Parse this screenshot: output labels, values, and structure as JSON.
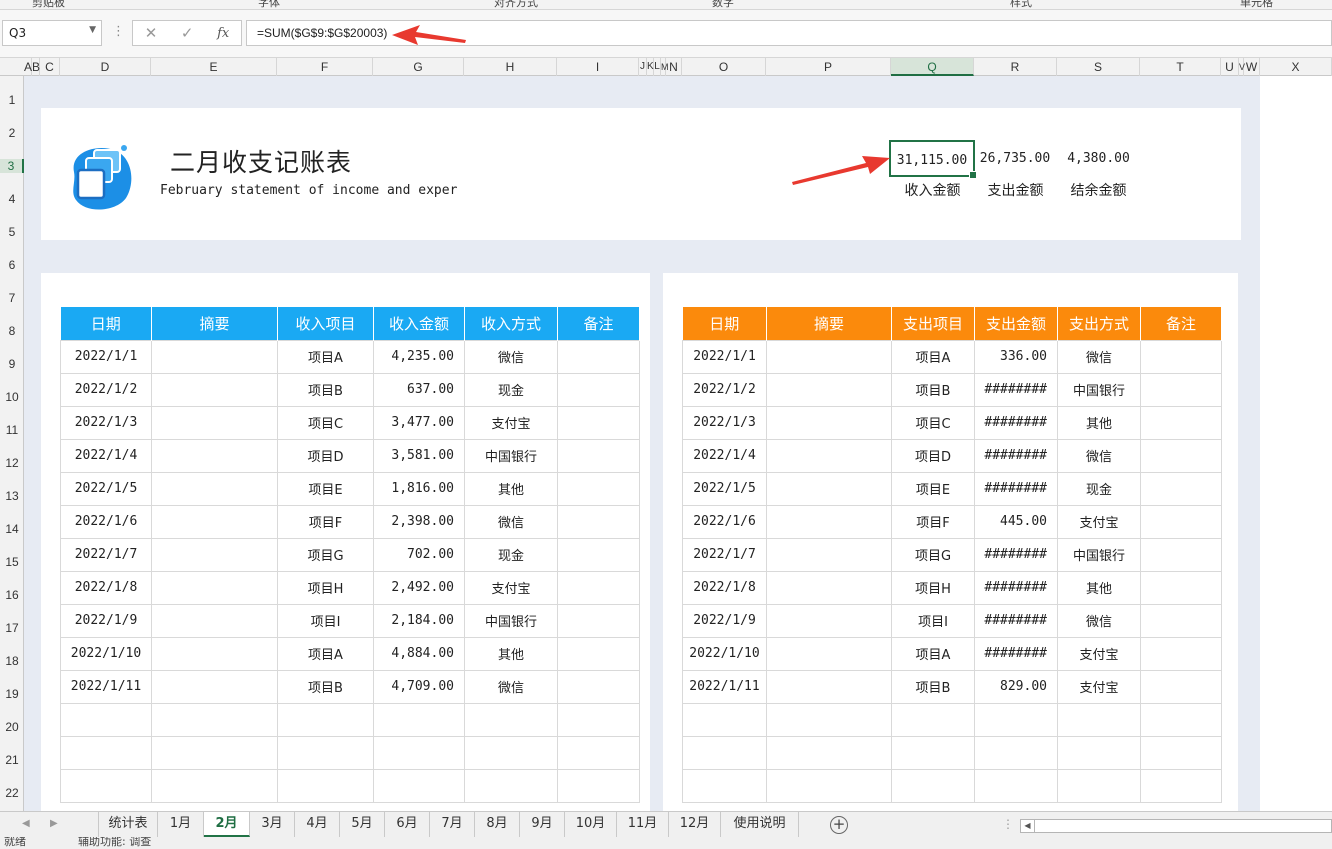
{
  "ribbon": {
    "groups": [
      "剪贴板",
      "字体",
      "对齐方式",
      "数字",
      "样式",
      "单元格"
    ]
  },
  "formula_bar": {
    "name_box": "Q3",
    "formula": "=SUM($G$9:$G$20003)",
    "fx_label": "fx",
    "cancel_glyph": "✕",
    "enter_glyph": "✓"
  },
  "columns": [
    "A",
    "B",
    "C",
    "D",
    "E",
    "F",
    "G",
    "H",
    "I",
    "J",
    "K",
    "L",
    "M",
    "N",
    "O",
    "P",
    "Q",
    "R",
    "S",
    "T",
    "U",
    "V",
    "W",
    "X"
  ],
  "rows": [
    "1",
    "2",
    "3",
    "4",
    "5",
    "6",
    "7",
    "8",
    "9",
    "10",
    "11",
    "12",
    "13",
    "14",
    "15",
    "16",
    "17",
    "18",
    "19",
    "20",
    "21",
    "22"
  ],
  "header": {
    "title": "二月收支记账表",
    "subtitle": "February statement of income and exper"
  },
  "summary": {
    "income_value": "31,115.00",
    "expense_value": "26,735.00",
    "balance_value": "4,380.00",
    "income_label": "收入金额",
    "expense_label": "支出金额",
    "balance_label": "结余金额"
  },
  "income_table": {
    "headers": [
      "日期",
      "摘要",
      "收入项目",
      "收入金额",
      "收入方式",
      "备注"
    ],
    "rows": [
      [
        "2022/1/1",
        "",
        "项目A",
        "4,235.00",
        "微信",
        ""
      ],
      [
        "2022/1/2",
        "",
        "项目B",
        "637.00",
        "现金",
        ""
      ],
      [
        "2022/1/3",
        "",
        "项目C",
        "3,477.00",
        "支付宝",
        ""
      ],
      [
        "2022/1/4",
        "",
        "项目D",
        "3,581.00",
        "中国银行",
        ""
      ],
      [
        "2022/1/5",
        "",
        "项目E",
        "1,816.00",
        "其他",
        ""
      ],
      [
        "2022/1/6",
        "",
        "项目F",
        "2,398.00",
        "微信",
        ""
      ],
      [
        "2022/1/7",
        "",
        "项目G",
        "702.00",
        "现金",
        ""
      ],
      [
        "2022/1/8",
        "",
        "项目H",
        "2,492.00",
        "支付宝",
        ""
      ],
      [
        "2022/1/9",
        "",
        "项目I",
        "2,184.00",
        "中国银行",
        ""
      ],
      [
        "2022/1/10",
        "",
        "项目A",
        "4,884.00",
        "其他",
        ""
      ],
      [
        "2022/1/11",
        "",
        "项目B",
        "4,709.00",
        "微信",
        ""
      ],
      [
        "",
        "",
        "",
        "",
        "",
        ""
      ],
      [
        "",
        "",
        "",
        "",
        "",
        ""
      ],
      [
        "",
        "",
        "",
        "",
        "",
        ""
      ]
    ]
  },
  "expense_table": {
    "headers": [
      "日期",
      "摘要",
      "支出项目",
      "支出金额",
      "支出方式",
      "备注"
    ],
    "rows": [
      [
        "2022/1/1",
        "",
        "项目A",
        "336.00",
        "微信",
        ""
      ],
      [
        "2022/1/2",
        "",
        "项目B",
        "########",
        "中国银行",
        ""
      ],
      [
        "2022/1/3",
        "",
        "项目C",
        "########",
        "其他",
        ""
      ],
      [
        "2022/1/4",
        "",
        "项目D",
        "########",
        "微信",
        ""
      ],
      [
        "2022/1/5",
        "",
        "项目E",
        "########",
        "现金",
        ""
      ],
      [
        "2022/1/6",
        "",
        "项目F",
        "445.00",
        "支付宝",
        ""
      ],
      [
        "2022/1/7",
        "",
        "项目G",
        "########",
        "中国银行",
        ""
      ],
      [
        "2022/1/8",
        "",
        "项目H",
        "########",
        "其他",
        ""
      ],
      [
        "2022/1/9",
        "",
        "项目I",
        "########",
        "微信",
        ""
      ],
      [
        "2022/1/10",
        "",
        "项目A",
        "########",
        "支付宝",
        ""
      ],
      [
        "2022/1/11",
        "",
        "项目B",
        "829.00",
        "支付宝",
        ""
      ],
      [
        "",
        "",
        "",
        "",
        "",
        ""
      ],
      [
        "",
        "",
        "",
        "",
        "",
        ""
      ],
      [
        "",
        "",
        "",
        "",
        "",
        ""
      ]
    ]
  },
  "sheet_tabs": [
    "统计表",
    "1月",
    "2月",
    "3月",
    "4月",
    "5月",
    "6月",
    "7月",
    "8月",
    "9月",
    "10月",
    "11月",
    "12月",
    "使用说明"
  ],
  "active_tab": "2月",
  "status_bar": {
    "ready": "就绪",
    "accessibility": "辅助功能: 调查"
  },
  "colors": {
    "income_header": "#1aa9f3",
    "expense_header": "#fb8a0c",
    "selection": "#217346",
    "annotation_arrow": "#e8392f"
  },
  "icons": [
    "cancel-icon",
    "enter-icon",
    "fx-icon",
    "dropdown-icon",
    "document-stack-logo-icon",
    "add-sheet-icon",
    "scroll-left-icon"
  ]
}
